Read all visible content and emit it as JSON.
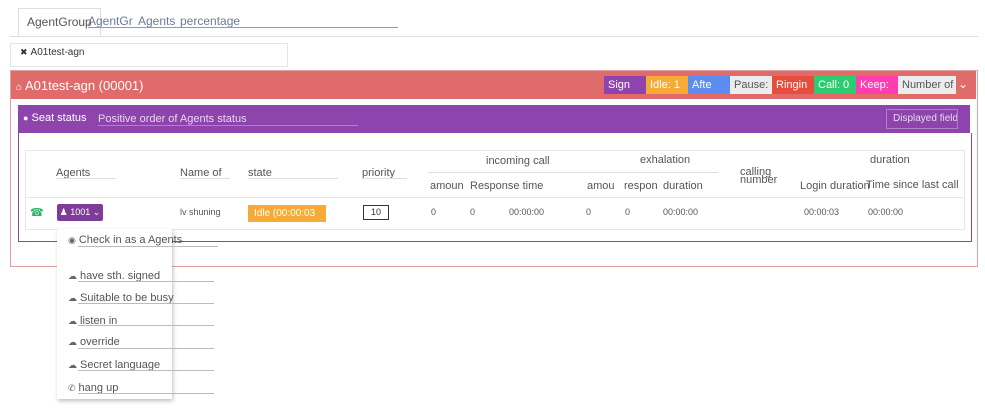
{
  "tabs": [
    "AgentGroup",
    "AgentGr",
    "Agents",
    "percentage"
  ],
  "filter_chip": "A01test-agn",
  "group_header": {
    "title": "A01test-agn  (00001)",
    "badges": [
      {
        "label": "Sign",
        "color": "#8e44ad"
      },
      {
        "label": "Idle: 1",
        "color": "#f5ab35"
      },
      {
        "label": "Afte",
        "color": "#5b8def"
      },
      {
        "label": "Pause:",
        "color": "#ececec"
      },
      {
        "label": "Ringin",
        "color": "#e74c3c"
      },
      {
        "label": "Call: 0",
        "color": "#2ecc71"
      },
      {
        "label": "Keep:",
        "color": "#ff3db0"
      },
      {
        "label": "Number of",
        "color": "#ececec"
      }
    ]
  },
  "seat_status": {
    "title": "Seat status",
    "sort_input": "Positive order of Agents status",
    "displayed_fields": "Displayed fields"
  },
  "table": {
    "group_headers": [
      "incoming call",
      "exhalation",
      "calling number",
      "duration"
    ],
    "columns": [
      "Agents",
      "Name of",
      "state",
      "priority",
      "amoun",
      "Response time",
      "amou",
      "respon",
      "duration",
      "Login duration",
      "Time since last call"
    ],
    "row": {
      "agent": "1001",
      "name": "lv shuning",
      "state": "Idle (00:00:03",
      "priority": "10",
      "in_amount": "0",
      "in_response": "0",
      "in_time": "00:00:00",
      "out_amount": "0",
      "out_response": "0",
      "out_duration": "00:00:00",
      "login_duration": "00:00:03",
      "since_last_call": "00:00:00"
    }
  },
  "menu": [
    "Check in as a Agents",
    "have sth. signed",
    "Suitable to be busy",
    "listen in",
    "override",
    "Secret language",
    "hang up"
  ],
  "colors": {
    "red_header": "#e06b6b",
    "purple_header": "#8e44ad",
    "idle": "#f5ab35",
    "agent_button": "#7d3c98"
  }
}
